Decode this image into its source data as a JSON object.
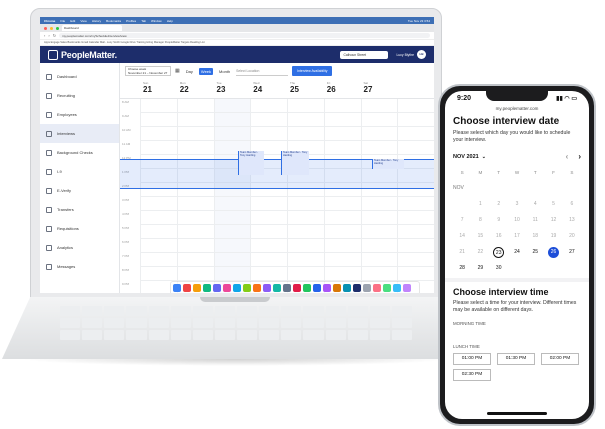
{
  "browser": {
    "menubar": [
      "Chrome",
      "File",
      "Edit",
      "View",
      "History",
      "Bookmarks",
      "Profiles",
      "Tab",
      "Window",
      "Help"
    ],
    "menubar_right": "Tue Nov 23 3:54",
    "tab_title": "Dashboard",
    "url": "my.peoplematter.com/myScheduleInterview/view",
    "bookmarks": "Apps  Engage  Sales  Bookmarks  Gmail  Calendar  Mail - Lucy Smith  Google Drive  Training  Hiring Manager  PeopleMatter  Targets  Reading List"
  },
  "app": {
    "logo": "PeopleMatter.",
    "store_select": "Calhoun Street",
    "user_name": "Lucy Blythe",
    "avatar_initials": "LB"
  },
  "sidebar": {
    "items": [
      {
        "label": "Dashboard"
      },
      {
        "label": "Recruiting"
      },
      {
        "label": "Employees"
      },
      {
        "label": "Interviews",
        "active": true
      },
      {
        "label": "Background Checks"
      },
      {
        "label": "I-9"
      },
      {
        "label": "E-Verify"
      },
      {
        "label": "Transfers"
      },
      {
        "label": "Requisitions"
      },
      {
        "label": "Analytics"
      },
      {
        "label": "Messages"
      }
    ]
  },
  "toolbar": {
    "date_label": "Choose week",
    "date_range": "November 21 – November 27",
    "views": [
      "Day",
      "Week",
      "Month"
    ],
    "active_view": "Week",
    "location_placeholder": "Select Location",
    "availability_button": "Interview Availability"
  },
  "week": {
    "days": [
      {
        "name": "Sun",
        "date": "21"
      },
      {
        "name": "Mon",
        "date": "22"
      },
      {
        "name": "Tue",
        "date": "23"
      },
      {
        "name": "Wed",
        "date": "24"
      },
      {
        "name": "Thu",
        "date": "25"
      },
      {
        "name": "Fri",
        "date": "26"
      },
      {
        "name": "Sat",
        "date": "27"
      }
    ],
    "times": [
      "8 AM",
      "9 AM",
      "10 AM",
      "11 AM",
      "12 PM",
      "1 PM",
      "2 PM",
      "3 PM",
      "4 PM",
      "5 PM",
      "6 PM",
      "7 PM",
      "8 PM",
      "9 PM"
    ],
    "event_text": "Team Member - Tony Harding"
  },
  "phone": {
    "time": "9:20",
    "url": "my.peoplematter.com",
    "date_heading": "Choose interview date",
    "date_text": "Please select which day you would like to schedule your interview.",
    "month": "NOV 2021",
    "weekdays": [
      "S",
      "M",
      "T",
      "W",
      "T",
      "F",
      "S"
    ],
    "month_abbr": "NOV",
    "days": [
      {
        "d": "",
        "s": ""
      },
      {
        "d": "1",
        "s": ""
      },
      {
        "d": "2",
        "s": ""
      },
      {
        "d": "3",
        "s": ""
      },
      {
        "d": "4",
        "s": ""
      },
      {
        "d": "5",
        "s": ""
      },
      {
        "d": "6",
        "s": ""
      },
      {
        "d": "7",
        "s": ""
      },
      {
        "d": "8",
        "s": ""
      },
      {
        "d": "9",
        "s": ""
      },
      {
        "d": "10",
        "s": ""
      },
      {
        "d": "11",
        "s": ""
      },
      {
        "d": "12",
        "s": ""
      },
      {
        "d": "13",
        "s": ""
      },
      {
        "d": "14",
        "s": ""
      },
      {
        "d": "15",
        "s": ""
      },
      {
        "d": "16",
        "s": ""
      },
      {
        "d": "17",
        "s": ""
      },
      {
        "d": "18",
        "s": ""
      },
      {
        "d": "19",
        "s": ""
      },
      {
        "d": "20",
        "s": ""
      },
      {
        "d": "21",
        "s": ""
      },
      {
        "d": "22",
        "s": ""
      },
      {
        "d": "23",
        "s": "ring"
      },
      {
        "d": "24",
        "s": "av"
      },
      {
        "d": "25",
        "s": "av"
      },
      {
        "d": "26",
        "s": "pick"
      },
      {
        "d": "27",
        "s": "av"
      },
      {
        "d": "28",
        "s": "av"
      },
      {
        "d": "29",
        "s": "av"
      },
      {
        "d": "30",
        "s": "av"
      },
      {
        "d": "",
        "s": ""
      },
      {
        "d": "",
        "s": ""
      },
      {
        "d": "",
        "s": ""
      },
      {
        "d": "",
        "s": ""
      }
    ],
    "time_heading": "Choose interview time",
    "time_text": "Please select a time for your interview. Different times may be available on different days.",
    "morning_label": "MORNING TIME",
    "lunch_label": "LUNCH TIME",
    "slots": [
      "01:00 PM",
      "01:30 PM",
      "02:00 PM"
    ],
    "slot_last": "02:30 PM"
  },
  "colors": {
    "brand_navy": "#1d2d6b",
    "accent_blue": "#2f6fe4",
    "selected_day": "#1d4ed8"
  }
}
